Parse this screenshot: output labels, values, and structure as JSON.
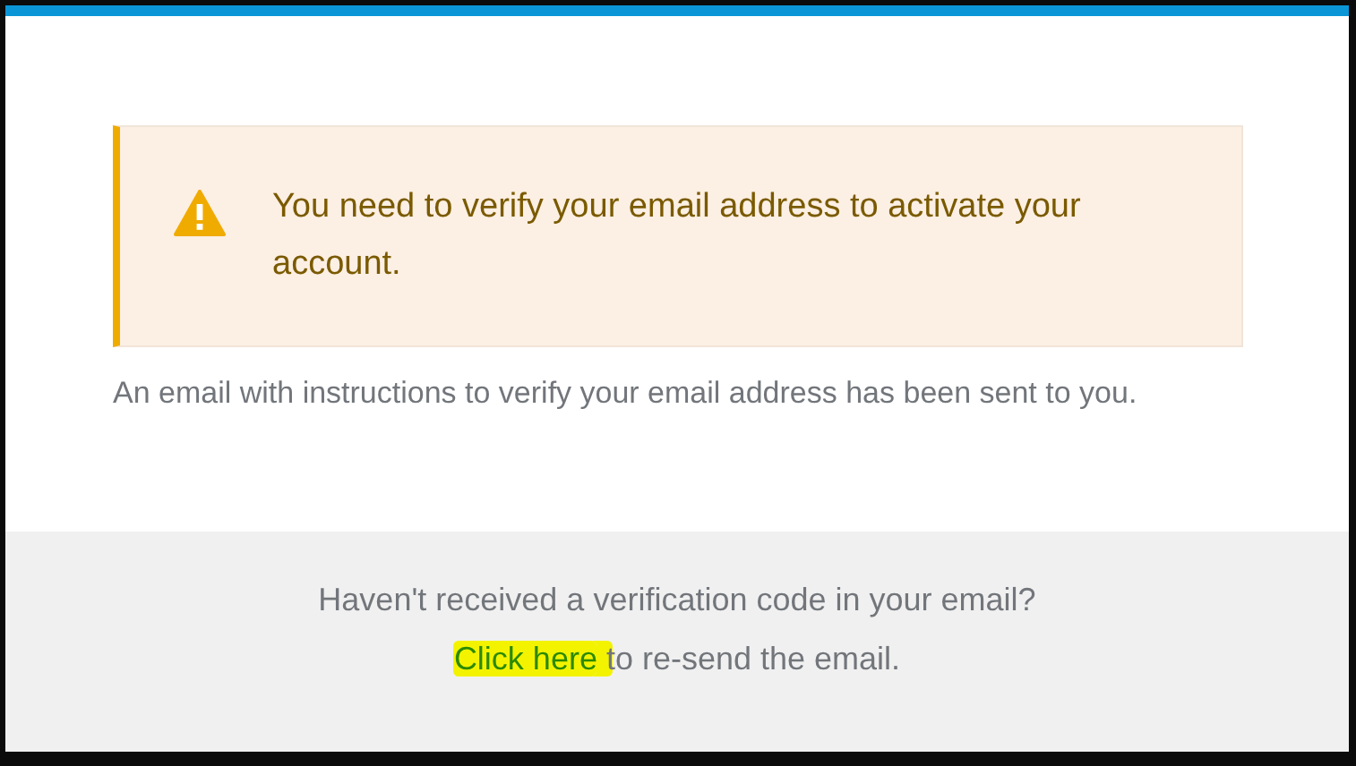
{
  "alert": {
    "kind": "warning",
    "message": "You need to verify your email address to activate your account."
  },
  "instruction": "An email with instructions to verify your email address has been sent to you.",
  "footer": {
    "question": "Haven't received a verification code in your email?",
    "link": "Click here",
    "rest": " to re-send the email."
  }
}
